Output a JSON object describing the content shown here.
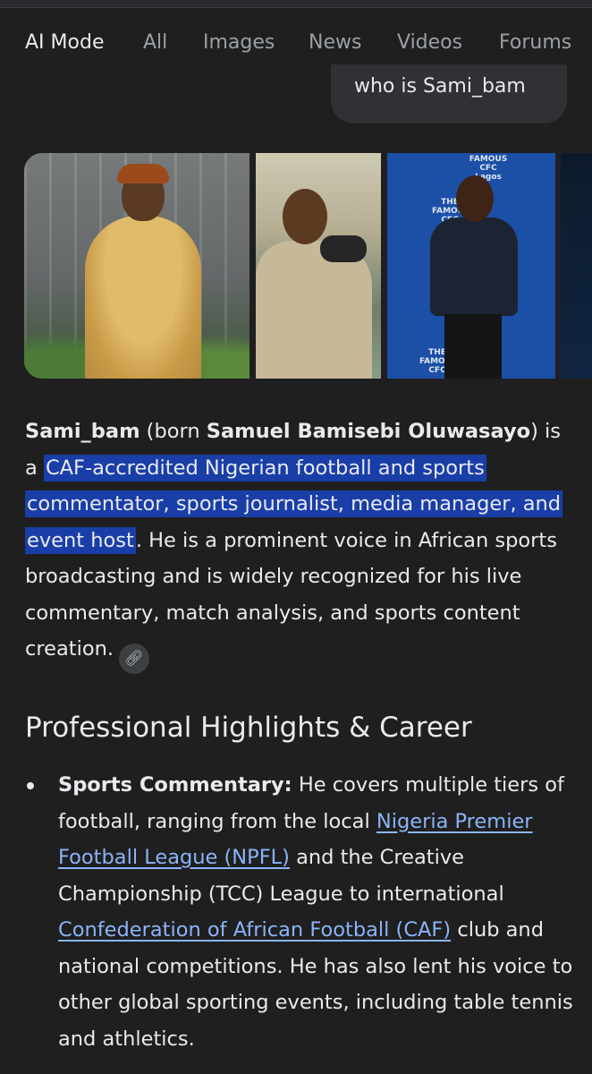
{
  "tabs": [
    {
      "label": "AI Mode"
    },
    {
      "label": "All"
    },
    {
      "label": "Images"
    },
    {
      "label": "News"
    },
    {
      "label": "Videos"
    },
    {
      "label": "Forums"
    }
  ],
  "query": "who is Sami_bam",
  "images": {
    "img3_text_1": "FAMOUS\nCFC\nLagos",
    "img3_text_2": "THE\nFAMOUS\nCFC",
    "img3_text_3": "THE\nFAMOUS\nCFC"
  },
  "answer": {
    "name_bold": "Sami_bam",
    "born_prefix": " (born ",
    "full_name_bold": "Samuel Bamisebi Oluwasayo",
    "born_suffix": ") is a ",
    "highlighted": "CAF-accredited Nigerian football and sports commentator, sports journalist, media manager, and event host",
    "rest": ". He is a prominent voice in African sports broadcasting and is widely recognized for his live commentary, match analysis, and sports content creation."
  },
  "section_heading": "Professional Highlights & Career",
  "bullets": [
    {
      "title": "Sports Commentary:",
      "text_1": " He covers multiple tiers of football, ranging from the local ",
      "link_1": "Nigeria Premier Football League (NPFL)",
      "text_2": " and the Creative Championship (TCC) League to international ",
      "link_2": "Confederation of African Football (CAF)",
      "text_3": " club and national competitions. He has also lent his voice to other global sporting events, including table tennis and athletics."
    }
  ],
  "colors": {
    "background": "#1f1f1f",
    "highlight": "#1a3ea8",
    "link": "#8ab4f8",
    "query_bubble": "#303134"
  }
}
